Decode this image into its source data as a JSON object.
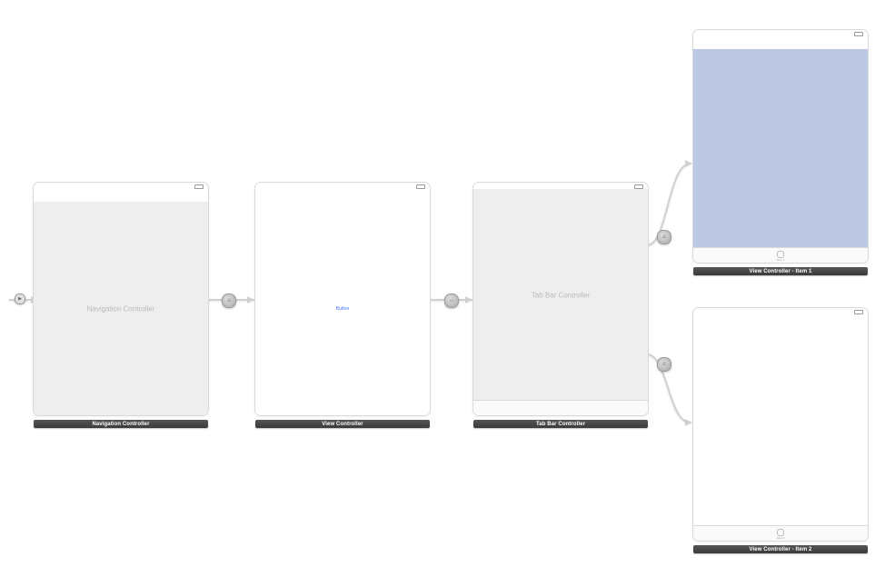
{
  "scenes": {
    "nav": {
      "title": "Navigation Controller",
      "bodyLabel": "Navigation Controller"
    },
    "root": {
      "title": "View Controller",
      "buttonLabel": "Button"
    },
    "tabbar": {
      "title": "Tab Bar Controller",
      "bodyLabel": "Tab Bar Controller"
    },
    "item1": {
      "title": "View Controller - Item 1",
      "tabItem": "Item 1"
    },
    "item2": {
      "title": "View Controller - Item 2",
      "tabItem": "Item 2"
    }
  },
  "segues": {
    "initial_arrow": "→",
    "root_relation": "root",
    "modal": "○",
    "tab_relation": "view"
  }
}
